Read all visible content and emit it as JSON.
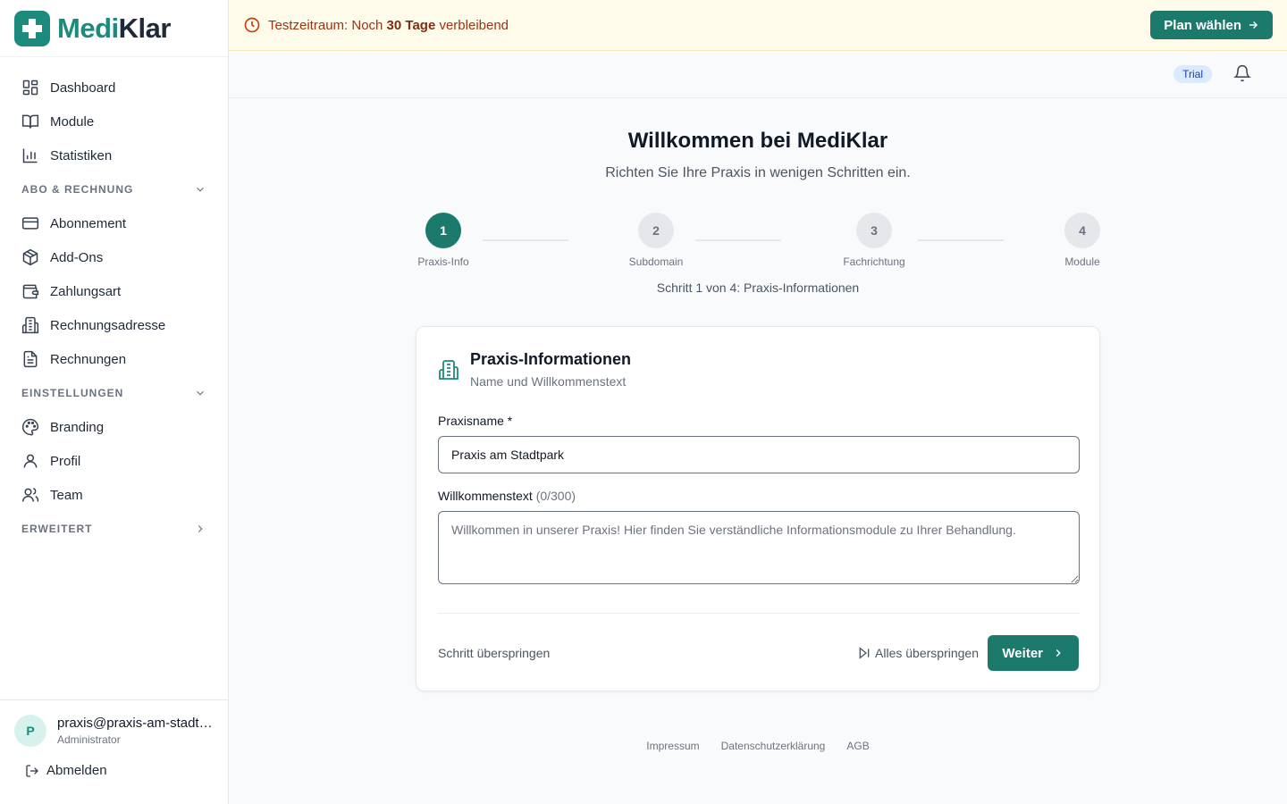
{
  "brand": {
    "name_part1": "Medi",
    "name_part2": "Klar",
    "accent_color": "#1c8a7c"
  },
  "sidebar": {
    "main_items": [
      {
        "label": "Dashboard",
        "icon": "dashboard-grid-icon"
      },
      {
        "label": "Module",
        "icon": "book-open-icon"
      },
      {
        "label": "Statistiken",
        "icon": "bar-chart-icon"
      }
    ],
    "section_billing": {
      "label": "ABO & RECHNUNG",
      "items": [
        {
          "label": "Abonnement",
          "icon": "credit-card-icon"
        },
        {
          "label": "Add-Ons",
          "icon": "package-icon"
        },
        {
          "label": "Zahlungsart",
          "icon": "wallet-icon"
        },
        {
          "label": "Rechnungsadresse",
          "icon": "building-icon"
        },
        {
          "label": "Rechnungen",
          "icon": "document-icon"
        }
      ]
    },
    "section_settings": {
      "label": "EINSTELLUNGEN",
      "items": [
        {
          "label": "Branding",
          "icon": "palette-icon"
        },
        {
          "label": "Profil",
          "icon": "user-icon"
        },
        {
          "label": "Team",
          "icon": "users-icon"
        }
      ]
    },
    "section_advanced": {
      "label": "ERWEITERT"
    },
    "user": {
      "initial": "P",
      "email": "praxis@praxis-am-stadtpark.de",
      "role": "Administrator"
    },
    "logout_label": "Abmelden"
  },
  "banner": {
    "prefix": "Testzeitraum: Noch ",
    "days": "30 Tage",
    "suffix": " verbleibend",
    "cta_label": "Plan wählen"
  },
  "topbar": {
    "badge": "Trial"
  },
  "onboarding": {
    "title": "Willkommen bei MediKlar",
    "subtitle": "Richten Sie Ihre Praxis in wenigen Schritten ein.",
    "steps": [
      {
        "number": "1",
        "label": "Praxis-Info",
        "active": true
      },
      {
        "number": "2",
        "label": "Subdomain",
        "active": false
      },
      {
        "number": "3",
        "label": "Fachrichtung",
        "active": false
      },
      {
        "number": "4",
        "label": "Module",
        "active": false
      }
    ],
    "step_info": "Schritt 1 von 4: Praxis-Informationen"
  },
  "card": {
    "title": "Praxis-Informationen",
    "subtitle": "Name und Willkommenstext",
    "name_label": "Praxisname *",
    "name_value": "Praxis am Stadtpark",
    "welcome_label": "Willkommenstext",
    "welcome_counter": "(0/300)",
    "welcome_placeholder": "Willkommen in unserer Praxis! Hier finden Sie verständliche Informationsmodule zu Ihrer Behandlung.",
    "skip_step_label": "Schritt überspringen",
    "skip_all_label": "Alles überspringen",
    "next_label": "Weiter"
  },
  "footer": {
    "links": [
      "Impressum",
      "Datenschutzerklärung",
      "AGB"
    ]
  }
}
